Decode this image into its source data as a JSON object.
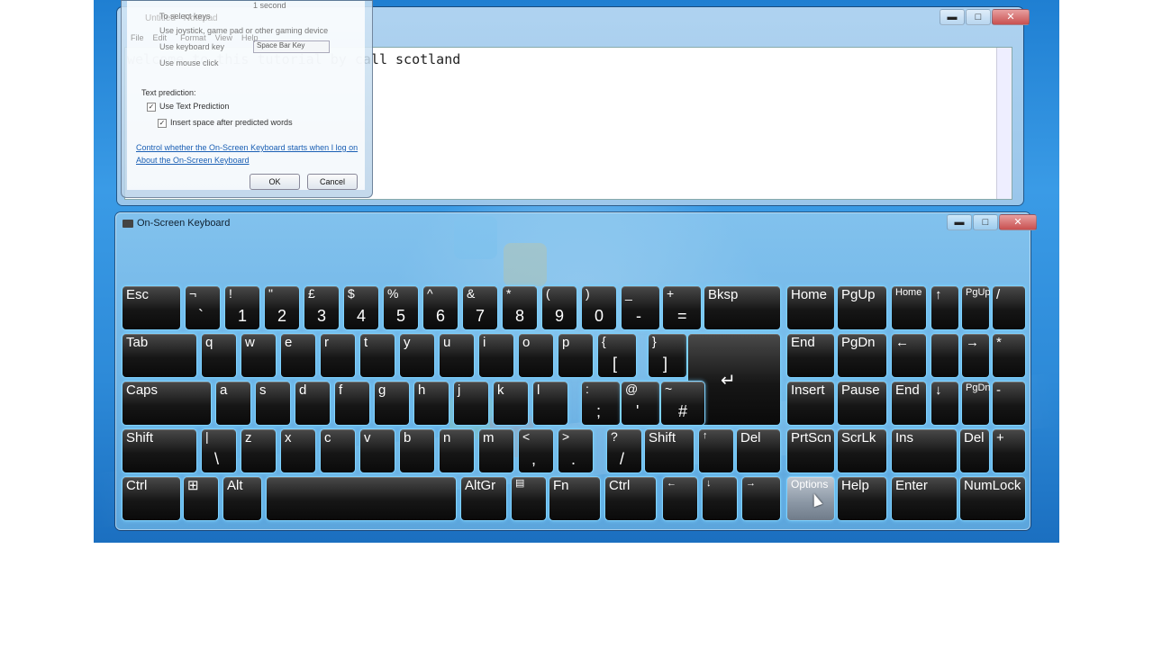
{
  "notepad": {
    "title": "Untitled - Notepad",
    "menu": [
      "File",
      "Edit",
      "Format",
      "View",
      "Help"
    ],
    "text": "welcome to this tutorial by call scotland",
    "cap_min": "▬",
    "cap_max": "□",
    "cap_close": "✕"
  },
  "options_dialog": {
    "faded_lines": [
      "1 second",
      "To select keys",
      "Use joystick, game pad or other gaming device",
      "Use keyboard key",
      "Use mouse click"
    ],
    "select_value": "Space Bar Key",
    "text_prediction_heading": "Text prediction:",
    "use_text_prediction": "Use Text Prediction",
    "insert_space": "Insert space after predicted words",
    "link1": "Control whether the On-Screen Keyboard starts when I log on",
    "link2": "About the On-Screen Keyboard",
    "ok": "OK",
    "cancel": "Cancel"
  },
  "osk": {
    "title": "On-Screen Keyboard",
    "cap_min": "▬",
    "cap_max": "□",
    "cap_close": "✕",
    "rows": [
      [
        {
          "p": "Esc"
        },
        {
          "s": "¬",
          "m": "`"
        },
        {
          "s": "!",
          "m": "1"
        },
        {
          "s": "\"",
          "m": "2"
        },
        {
          "s": "£",
          "m": "3"
        },
        {
          "s": "$",
          "m": "4"
        },
        {
          "s": "%",
          "m": "5"
        },
        {
          "s": "^",
          "m": "6"
        },
        {
          "s": "&",
          "m": "7"
        },
        {
          "s": "*",
          "m": "8"
        },
        {
          "s": "(",
          "m": "9"
        },
        {
          "s": ")",
          "m": "0"
        },
        {
          "s": "_",
          "m": "-"
        },
        {
          "s": "+",
          "m": "="
        },
        {
          "p": "Bksp"
        },
        {
          "p": "Home"
        },
        {
          "p": "PgUp"
        },
        {
          "p": "Home",
          "small": true
        },
        {
          "p": "↑"
        },
        {
          "p": "PgUp",
          "small": true
        },
        {
          "p": "/"
        }
      ],
      [
        {
          "p": "Tab"
        },
        {
          "p": "q"
        },
        {
          "p": "w"
        },
        {
          "p": "e"
        },
        {
          "p": "r"
        },
        {
          "p": "t"
        },
        {
          "p": "y"
        },
        {
          "p": "u"
        },
        {
          "p": "i"
        },
        {
          "p": "o"
        },
        {
          "p": "p"
        },
        {
          "s": "{",
          "m": "["
        },
        {
          "s": "}",
          "m": "]"
        },
        {
          "p": "↵"
        },
        {
          "p": "End"
        },
        {
          "p": "PgDn"
        },
        {
          "p": "←"
        },
        {
          "p": ""
        },
        {
          "p": "→"
        },
        {
          "p": "*"
        }
      ],
      [
        {
          "p": "Caps"
        },
        {
          "p": "a"
        },
        {
          "p": "s"
        },
        {
          "p": "d"
        },
        {
          "p": "f"
        },
        {
          "p": "g"
        },
        {
          "p": "h"
        },
        {
          "p": "j"
        },
        {
          "p": "k"
        },
        {
          "p": "l"
        },
        {
          "s": ":",
          "m": ";"
        },
        {
          "s": "@",
          "m": "'"
        },
        {
          "s": "~",
          "m": "#"
        },
        {
          "p": "Insert"
        },
        {
          "p": "Pause"
        },
        {
          "p": "End"
        },
        {
          "p": "↓"
        },
        {
          "p": "PgDn",
          "small": true
        },
        {
          "p": "-"
        }
      ],
      [
        {
          "p": "Shift"
        },
        {
          "s": "|",
          "m": "\\"
        },
        {
          "p": "z"
        },
        {
          "p": "x"
        },
        {
          "p": "c"
        },
        {
          "p": "v"
        },
        {
          "p": "b"
        },
        {
          "p": "n"
        },
        {
          "p": "m"
        },
        {
          "s": "<",
          "m": ","
        },
        {
          "s": ">",
          "m": "."
        },
        {
          "s": "?",
          "m": "/"
        },
        {
          "p": "Shift"
        },
        {
          "p": "↑",
          "small": true
        },
        {
          "p": "Del"
        },
        {
          "p": "PrtScn"
        },
        {
          "p": "ScrLk"
        },
        {
          "p": "Ins"
        },
        {
          "p": "Del"
        },
        {
          "p": "+"
        }
      ],
      [
        {
          "p": "Ctrl"
        },
        {
          "p": "⊞"
        },
        {
          "p": "Alt"
        },
        {
          "p": ""
        },
        {
          "p": "AltGr"
        },
        {
          "p": "▤",
          "small": true
        },
        {
          "p": "Fn"
        },
        {
          "p": "Ctrl"
        },
        {
          "p": "←",
          "small": true
        },
        {
          "p": "↓",
          "small": true
        },
        {
          "p": "→",
          "small": true
        },
        {
          "p": "Options",
          "opt": true
        },
        {
          "p": "Help"
        },
        {
          "p": "Enter"
        },
        {
          "p": "NumLock"
        }
      ]
    ]
  }
}
